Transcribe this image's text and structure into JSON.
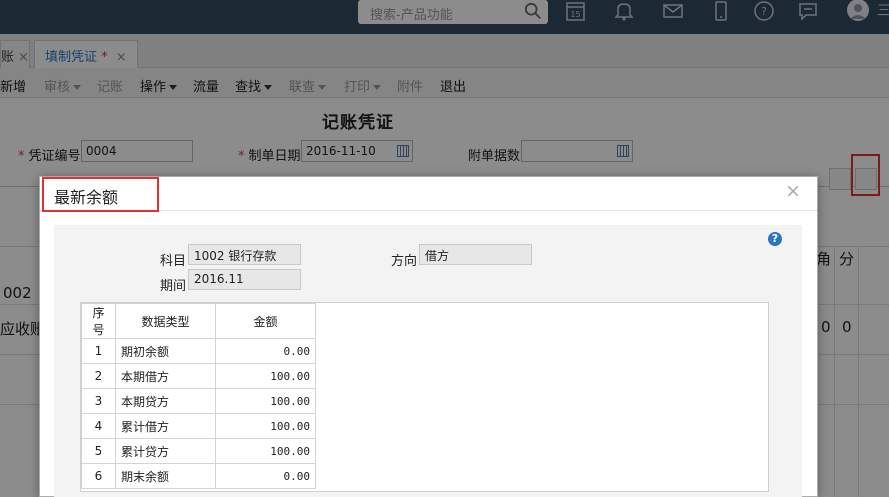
{
  "topbar": {
    "search_placeholder": "搜索-产品功能",
    "calendar_day": "15",
    "icons": [
      "search-icon",
      "calendar-icon",
      "bell-icon",
      "mail-icon",
      "mobile-icon",
      "help-icon",
      "chat-icon",
      "avatar"
    ]
  },
  "tabs": [
    {
      "label": "账",
      "close": "×"
    },
    {
      "label": "填制凭证",
      "modified": "*",
      "close": "×"
    }
  ],
  "toolbar": {
    "items": [
      {
        "label": "新增",
        "enabled": true
      },
      {
        "label": "审核",
        "enabled": false,
        "dropdown": true
      },
      {
        "label": "记账",
        "enabled": false
      },
      {
        "label": "操作",
        "enabled": true,
        "dropdown": true
      },
      {
        "label": "流量",
        "enabled": true
      },
      {
        "label": "查找",
        "enabled": true,
        "dropdown": true
      },
      {
        "label": "联查",
        "enabled": false,
        "dropdown": true
      },
      {
        "label": "打印",
        "enabled": false,
        "dropdown": true
      },
      {
        "label": "附件",
        "enabled": false
      },
      {
        "label": "退出",
        "enabled": true
      }
    ]
  },
  "voucher": {
    "title": "记账凭证",
    "required_mark": "*",
    "no_label": "凭证编号",
    "no_value": "0004",
    "date_label": "制单日期",
    "date_value": "2016-11-10",
    "attach_label": "附单据数",
    "attach_value": "",
    "col_jiao": "角",
    "col_fen": "分",
    "row_code": "002",
    "row_text": "应收账",
    "row_jiao": "0",
    "row_fen": "0"
  },
  "modal": {
    "title": "最新余额",
    "close": "×",
    "help": "?",
    "subject_label": "科目",
    "subject_value": "1002 银行存款",
    "direction_label": "方向",
    "direction_value": "借方",
    "period_label": "期间",
    "period_value": "2016.11",
    "columns": [
      "序号",
      "数据类型",
      "金额"
    ],
    "rows": [
      {
        "no": "1",
        "type": "期初余额",
        "amount": "0.00"
      },
      {
        "no": "2",
        "type": "本期借方",
        "amount": "100.00"
      },
      {
        "no": "3",
        "type": "本期贷方",
        "amount": "100.00"
      },
      {
        "no": "4",
        "type": "累计借方",
        "amount": "100.00"
      },
      {
        "no": "5",
        "type": "累计贷方",
        "amount": "100.00"
      },
      {
        "no": "6",
        "type": "期末余额",
        "amount": "0.00"
      }
    ]
  },
  "colors": {
    "topbar": "#34495e",
    "tab_active_text": "#2b78c2",
    "required": "#d93a3a",
    "highlight_box": "#e03232",
    "help_icon": "#2a74c9"
  }
}
